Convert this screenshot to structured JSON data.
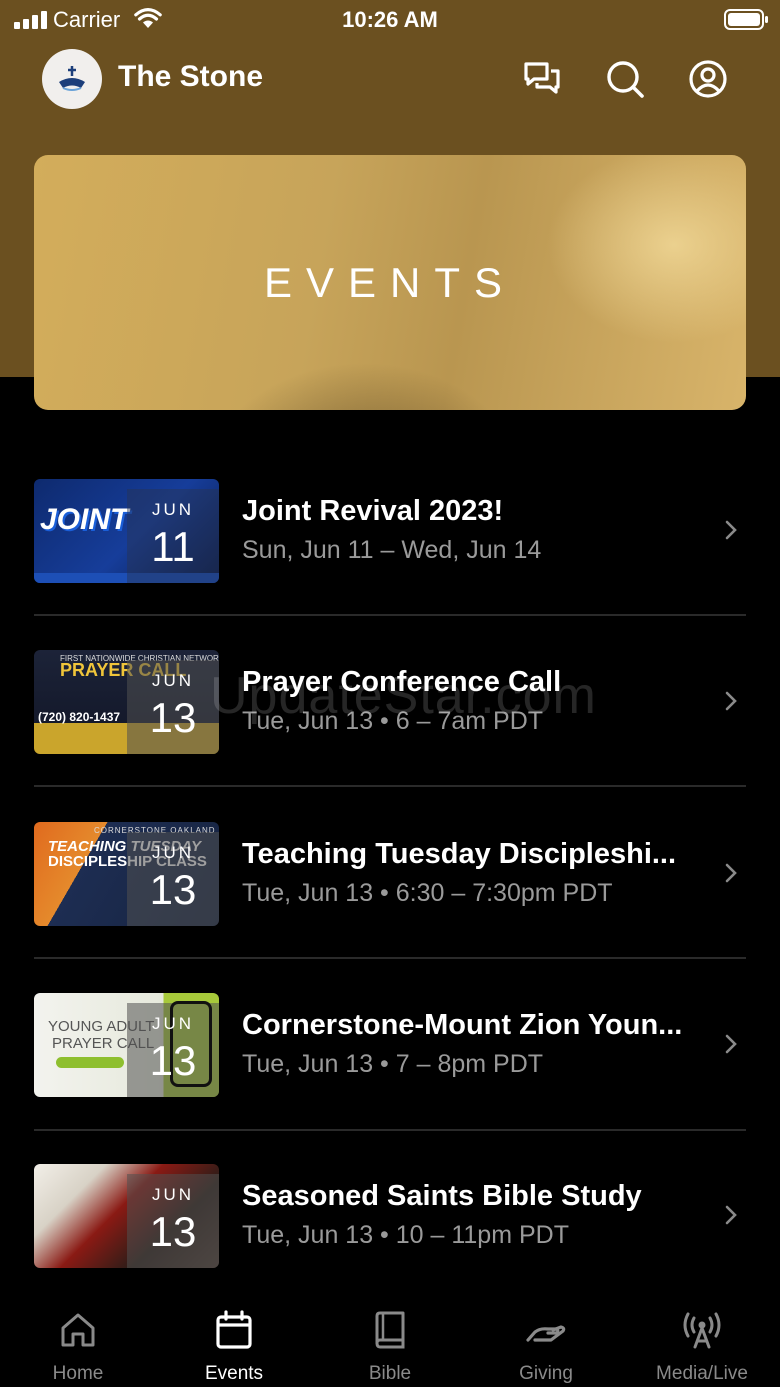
{
  "status_bar": {
    "carrier": "Carrier",
    "time": "10:26 AM"
  },
  "header": {
    "title": "The Stone"
  },
  "hero": {
    "text": "EVENTS"
  },
  "events": [
    {
      "title": "Joint Revival 2023!",
      "subtitle": "Sun, Jun 11 – Wed, Jun 14",
      "month": "JUN",
      "day": "11"
    },
    {
      "title": "Prayer Conference Call",
      "subtitle": "Tue, Jun 13 • 6 – 7am PDT",
      "month": "JUN",
      "day": "13"
    },
    {
      "title": "Teaching Tuesday Discipleshi...",
      "subtitle": "Tue, Jun 13 • 6:30 – 7:30pm PDT",
      "month": "JUN",
      "day": "13"
    },
    {
      "title": "Cornerstone-Mount Zion Youn...",
      "subtitle": "Tue, Jun 13 • 7 – 8pm PDT",
      "month": "JUN",
      "day": "13"
    },
    {
      "title": "Seasoned Saints Bible Study",
      "subtitle": "Tue, Jun 13 • 10 – 11pm PDT",
      "month": "JUN",
      "day": "13"
    }
  ],
  "thumb_art": {
    "joint": "JOINT",
    "prayer_net": "FIRST NATIONWIDE CHRISTIAN NETWORK",
    "prayer_call": "PRAYER CALL",
    "prayer_phone": "(720) 820-1437",
    "teaching_org": "CORNERSTONE OAKLAND",
    "teaching_1": "TEACHING TUESDAY",
    "teaching_2": "DISCIPLESHIP CLASS",
    "young_1": "YOUNG ADULT",
    "young_2": "PRAYER CALL"
  },
  "watermark": "UpdateStar.com",
  "tabs": [
    {
      "label": "Home",
      "icon": "home-icon",
      "active": false
    },
    {
      "label": "Events",
      "icon": "calendar-icon",
      "active": true
    },
    {
      "label": "Bible",
      "icon": "book-icon",
      "active": false
    },
    {
      "label": "Giving",
      "icon": "giving-hand-icon",
      "active": false
    },
    {
      "label": "Media/Live",
      "icon": "broadcast-icon",
      "active": false
    }
  ],
  "colors": {
    "header_bg": "#6b5020",
    "background": "#000000",
    "subtitle": "#9a9a9a",
    "inactive_tab": "#8a8a8a"
  }
}
